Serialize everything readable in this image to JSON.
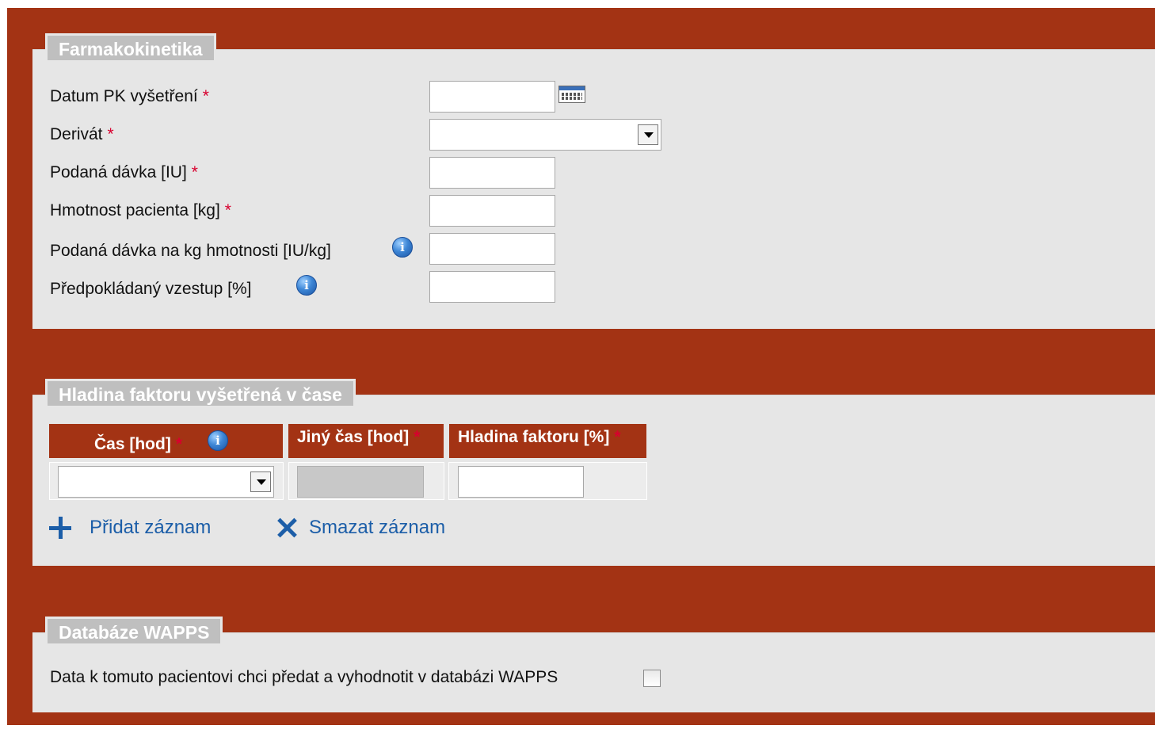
{
  "farmakokinetika": {
    "legend": "Farmakokinetika",
    "fields": [
      {
        "label": "Datum PK vyšetření",
        "required": "*",
        "value": ""
      },
      {
        "label": "Derivát",
        "required": "*",
        "value": ""
      },
      {
        "label": "Podaná dávka [IU]",
        "required": "*",
        "value": ""
      },
      {
        "label": "Hmotnost pacienta [kg]",
        "required": "*",
        "value": ""
      },
      {
        "label": "Podaná dávka na kg hmotnosti [IU/kg]",
        "value": ""
      },
      {
        "label": "Předpokládaný vzestup [%]",
        "value": ""
      }
    ],
    "info_glyph": "i",
    "calendar_icon": "calendar-icon"
  },
  "hladina": {
    "legend": "Hladina faktoru vyšetřená v čase",
    "columns": [
      {
        "label": "Čas [hod]",
        "required": "*"
      },
      {
        "label": "Jiný čas [hod]",
        "required": "*"
      },
      {
        "label": "Hladina faktoru [%]",
        "required": "*"
      }
    ],
    "row": {
      "cas": "",
      "jiny_cas": "",
      "hladina": ""
    },
    "add_label": "Přidat záznam",
    "delete_label": "Smazat záznam"
  },
  "wapps": {
    "legend": "Databáze WAPPS",
    "checkbox_label": "Data k tomuto pacientovi chci předat a vyhodnotit v databázi WAPPS",
    "checked": false
  },
  "colors": {
    "frame": "#a33314",
    "panel": "#e6e6e6",
    "legend": "#bfbfbf",
    "required": "#d8002e",
    "link": "#1c5ea8"
  }
}
